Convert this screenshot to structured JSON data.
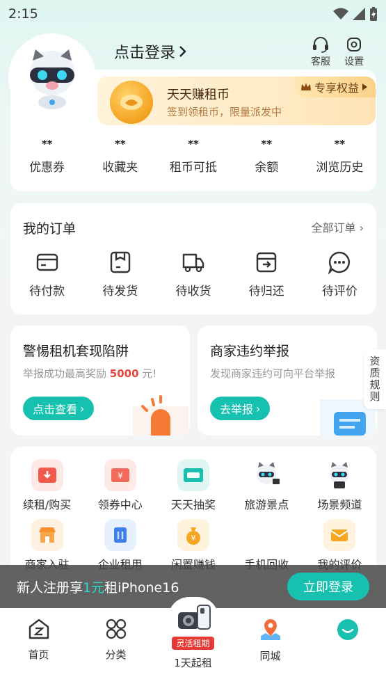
{
  "status_bar": {
    "time": "2:15"
  },
  "header": {
    "login_label": "点击登录",
    "customer_service": "客服",
    "settings": "设置"
  },
  "coin_banner": {
    "title": "天天赚租币",
    "subtitle": "签到领租币，限量派发中",
    "vip_label": "专享权益"
  },
  "stats": [
    {
      "value": "**",
      "label": "优惠券"
    },
    {
      "value": "**",
      "label": "收藏夹"
    },
    {
      "value": "**",
      "label": "租币可抵"
    },
    {
      "value": "**",
      "label": "余额"
    },
    {
      "value": "**",
      "label": "浏览历史"
    }
  ],
  "orders": {
    "title": "我的订单",
    "all_label": "全部订单",
    "items": [
      {
        "label": "待付款",
        "icon": "wallet-icon"
      },
      {
        "label": "待发货",
        "icon": "package-icon"
      },
      {
        "label": "待收货",
        "icon": "truck-icon"
      },
      {
        "label": "待归还",
        "icon": "return-icon"
      },
      {
        "label": "待评价",
        "icon": "comment-icon"
      }
    ]
  },
  "promos": [
    {
      "title": "警惕租机套现陷阱",
      "sub_prefix": "举报成功最高奖励 ",
      "sub_amount": "5000",
      "sub_suffix": " 元!",
      "button": "点击查看"
    },
    {
      "title": "商家违约举报",
      "sub": "发现商家违约可向平台举报",
      "button": "去举报"
    }
  ],
  "side_rule": "资质规则",
  "services": [
    {
      "label": "续租/购买",
      "icon": "renew-icon",
      "color": "#f05a4c"
    },
    {
      "label": "领券中心",
      "icon": "coupon-icon",
      "color": "#f26b5b"
    },
    {
      "label": "天天抽奖",
      "icon": "lottery-icon",
      "color": "#19c0b0"
    },
    {
      "label": "旅游景点",
      "icon": "travel-mascot-icon",
      "color": "#4a9fe0"
    },
    {
      "label": "场景频道",
      "icon": "scene-mascot-icon",
      "color": "#4a9fe0"
    },
    {
      "label": "商家入驻",
      "icon": "store-icon",
      "color": "#f5902a"
    },
    {
      "label": "企业租用",
      "icon": "building-icon",
      "color": "#3f7fe8"
    },
    {
      "label": "闲置赚钱",
      "icon": "money-bag-icon",
      "color": "#f5a623"
    },
    {
      "label": "手机回收",
      "icon": "phone-recycle-icon",
      "color": "#888888"
    },
    {
      "label": "我的评价",
      "icon": "mail-icon",
      "color": "#f5a623"
    }
  ],
  "register_banner": {
    "prefix": "新人注册享",
    "highlight": "1元",
    "suffix": "租iPhone16",
    "button": "立即登录"
  },
  "bottom_nav": [
    {
      "label": "首页",
      "icon": "home-icon"
    },
    {
      "label": "分类",
      "icon": "grid-icon"
    },
    {
      "label": "1天起租",
      "icon": "camera-phone-icon",
      "badge": "灵活租期"
    },
    {
      "label": "同城",
      "icon": "location-icon"
    },
    {
      "label": "",
      "icon": "mascot-face-icon"
    }
  ]
}
